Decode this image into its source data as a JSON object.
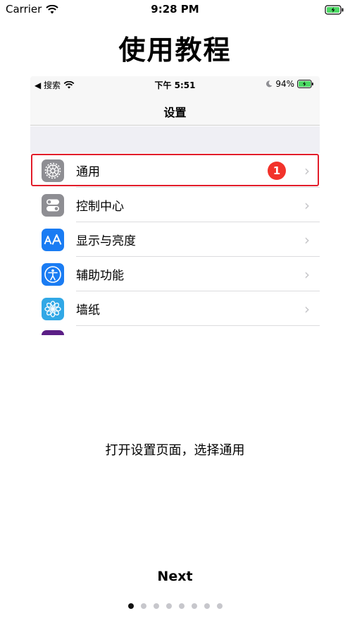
{
  "status_bar": {
    "carrier": "Carrier",
    "time": "9:28 PM"
  },
  "page": {
    "title": "使用教程",
    "caption": "打开设置页面，选择通用",
    "next_label": "Next"
  },
  "embedded_screenshot": {
    "status_bar": {
      "back_label": "◀ 搜索",
      "time": "下午 5:51",
      "battery": "94%"
    },
    "nav_title": "设置",
    "rows": [
      {
        "label": "通用",
        "icon": "gear-icon",
        "icon_color": "#8e8e93",
        "badge": "1",
        "highlighted": true
      },
      {
        "label": "控制中心",
        "icon": "toggle-icon",
        "icon_color": "#8e8e93"
      },
      {
        "label": "显示与亮度",
        "icon": "text-size-icon",
        "icon_color": "#1a7cf3"
      },
      {
        "label": "辅助功能",
        "icon": "accessibility-icon",
        "icon_color": "#1a7cf3"
      },
      {
        "label": "墙纸",
        "icon": "flower-icon",
        "icon_color": "#31a8e6"
      }
    ]
  },
  "pagination": {
    "total": 8,
    "current": 1
  },
  "colors": {
    "highlight_border": "#e21d2a",
    "badge": "#f2332b",
    "battery_green": "#4cd964"
  }
}
